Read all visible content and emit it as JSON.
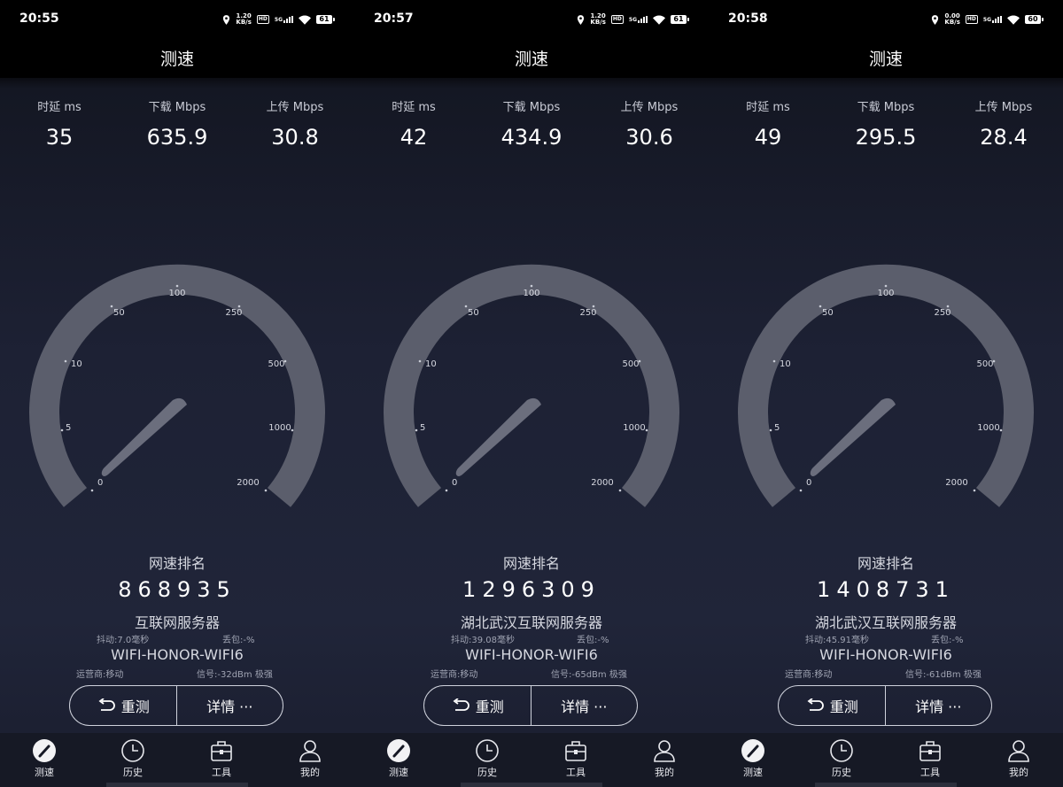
{
  "app": {
    "title": "测速"
  },
  "labels": {
    "latency": "时延 ms",
    "download": "下载 Mbps",
    "upload": "上传 Mbps",
    "rank": "网速排名",
    "retest": "重测",
    "details": "详情 ···"
  },
  "gauge_ticks": [
    "0",
    "5",
    "10",
    "50",
    "100",
    "250",
    "500",
    "1000",
    "2000"
  ],
  "tabs": [
    "测速",
    "历史",
    "工具",
    "我的"
  ],
  "colors": {
    "background": "#1d2134",
    "gauge": "#5b5e6c",
    "needle": "#6b6e7d",
    "statusbar": "#000000"
  },
  "panels": [
    {
      "status": {
        "time": "20:55",
        "rate_top": "1.20",
        "rate_unit": "KB/s",
        "battery": "61"
      },
      "latency": "35",
      "download": "635.9",
      "upload": "30.8",
      "rank": "868935",
      "server": "互联网服务器",
      "jitter": "抖动:7.0毫秒",
      "packet_loss": "丢包:-%",
      "ssid": "WIFI-HONOR-WIFI6",
      "carrier": "运营商:移动",
      "signal": "信号:-32dBm 极强"
    },
    {
      "status": {
        "time": "20:57",
        "rate_top": "1.20",
        "rate_unit": "KB/s",
        "battery": "61"
      },
      "latency": "42",
      "download": "434.9",
      "upload": "30.6",
      "rank": "1296309",
      "server": "湖北武汉互联网服务器",
      "jitter": "抖动:39.08毫秒",
      "packet_loss": "丢包:-%",
      "ssid": "WIFI-HONOR-WIFI6",
      "carrier": "运营商:移动",
      "signal": "信号:-65dBm 极强"
    },
    {
      "status": {
        "time": "20:58",
        "rate_top": "0.00",
        "rate_unit": "KB/s",
        "battery": "60"
      },
      "latency": "49",
      "download": "295.5",
      "upload": "28.4",
      "rank": "1408731",
      "server": "湖北武汉互联网服务器",
      "jitter": "抖动:45.91毫秒",
      "packet_loss": "丢包:-%",
      "ssid": "WIFI-HONOR-WIFI6",
      "carrier": "运营商:移动",
      "signal": "信号:-61dBm 极强"
    }
  ]
}
